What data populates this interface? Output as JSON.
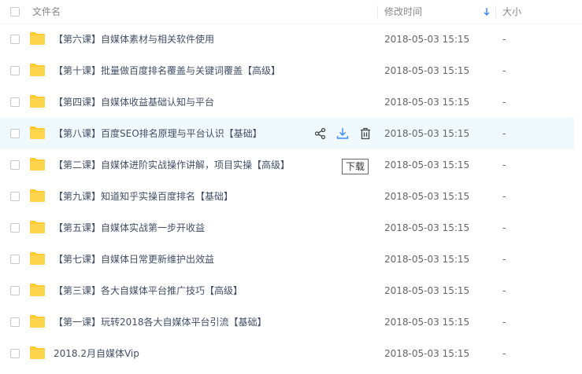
{
  "header": {
    "name_label": "文件名",
    "time_label": "修改时间",
    "size_label": "大小",
    "sort_icon": "sort-down-arrow-icon"
  },
  "rows": [
    {
      "name": "【第六课】自媒体素材与相关软件使用",
      "time": "2018-05-03 15:15",
      "size": "-"
    },
    {
      "name": "【第十课】批量做百度排名覆盖与关键词覆盖【高级】",
      "time": "2018-05-03 15:15",
      "size": "-"
    },
    {
      "name": "【第四课】自媒体收益基础认知与平台",
      "time": "2018-05-03 15:15",
      "size": "-"
    },
    {
      "name": "【第八课】百度SEO排名原理与平台认识【基础】",
      "time": "2018-05-03 15:15",
      "size": "-"
    },
    {
      "name": "【第二课】自媒体进阶实战操作讲解，项目实操【高级】",
      "time": "2018-05-03 15:15",
      "size": "-"
    },
    {
      "name": "【第九课】知道知乎实操百度排名【基础】",
      "time": "2018-05-03 15:15",
      "size": "-"
    },
    {
      "name": "【第五课】自媒体实战第一步开收益",
      "time": "2018-05-03 15:15",
      "size": "-"
    },
    {
      "name": "【第七课】自媒体日常更新维护出效益",
      "time": "2018-05-03 15:15",
      "size": "-"
    },
    {
      "name": "【第三课】各大自媒体平台推广技巧【高级】",
      "time": "2018-05-03 15:15",
      "size": "-"
    },
    {
      "name": "【第一课】玩转2018各大自媒体平台引流【基础】",
      "time": "2018-05-03 15:15",
      "size": "-"
    },
    {
      "name": "2018.2月自媒体Vip",
      "time": "2018-05-03 15:15",
      "size": "-"
    }
  ],
  "hover_row_index": 3,
  "row_actions": [
    "share-icon",
    "download-icon",
    "delete-icon"
  ],
  "tooltip": "下载",
  "colors": {
    "hover_bg": "#f0f9fe",
    "accent": "#3b8cff",
    "folder": "#ffc933"
  }
}
